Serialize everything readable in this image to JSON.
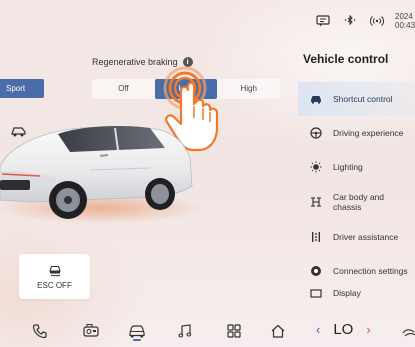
{
  "status": {
    "time_line1": "2024",
    "time_line2": "00:43"
  },
  "drive_mode": {
    "active_label": "Sport"
  },
  "regen": {
    "title": "Regenerative braking",
    "info_glyph": "i",
    "options": [
      "Off",
      "Low",
      "High"
    ],
    "selected": "Low"
  },
  "esc": {
    "label": "ESC OFF"
  },
  "vehicle_control": {
    "title": "Vehicle control",
    "menu": [
      {
        "label": "Shortcut control",
        "icon": "car-icon",
        "active": true
      },
      {
        "label": "Driving experience",
        "icon": "steering-wheel-icon",
        "active": false
      },
      {
        "label": "Lighting",
        "icon": "light-icon",
        "active": false
      },
      {
        "label": "Car body and chassis",
        "icon": "chassis-icon",
        "active": false
      },
      {
        "label": "Driver assistance",
        "icon": "assist-icon",
        "active": false
      },
      {
        "label": "Connection settings",
        "icon": "connection-icon",
        "active": false
      },
      {
        "label": "Display",
        "icon": "display-icon",
        "active": false
      }
    ]
  },
  "dock": {
    "temperature": "LO",
    "items": [
      "phone-icon",
      "dashcam-icon",
      "vehicle-icon",
      "music-icon",
      "apps-icon",
      "home-icon"
    ]
  },
  "colors": {
    "accent": "#4a6ca8",
    "temp_left_arrow": "#3b63c9",
    "temp_right_arrow": "#e0435a",
    "touch_ring": "#f07a2a"
  }
}
